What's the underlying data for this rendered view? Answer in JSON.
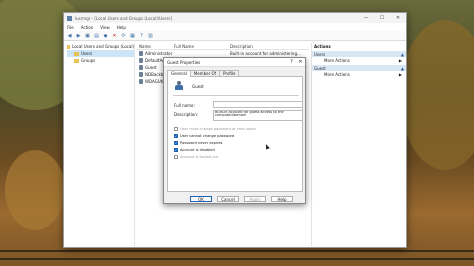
{
  "window": {
    "title": "lusrmgr - [Local Users and Groups (Local)\\Users]",
    "controls": [
      "—",
      "☐",
      "✕"
    ]
  },
  "menu": [
    "File",
    "Action",
    "View",
    "Help"
  ],
  "tree": {
    "root": "Local Users and Groups (Local)",
    "items": [
      "Users",
      "Groups"
    ]
  },
  "list": {
    "headers": {
      "name": "Name",
      "full_name": "Full Name",
      "description": "Description"
    },
    "rows": [
      {
        "name": "Administrator",
        "description": "Built-in account for administering..."
      },
      {
        "name": "DefaultAcc",
        "description": ""
      },
      {
        "name": "Guest",
        "description": ""
      },
      {
        "name": "NDBackb",
        "description": ""
      },
      {
        "name": "WDAGUtility",
        "description": ""
      }
    ]
  },
  "actions": {
    "header": "Actions",
    "sections": [
      {
        "title": "Users",
        "item": "More Actions"
      },
      {
        "title": "Guest",
        "item": "More Actions"
      }
    ]
  },
  "dialog": {
    "title": "Guest Properties",
    "help_btn": "?",
    "close_btn": "✕",
    "tabs": [
      "General",
      "Member Of",
      "Profile"
    ],
    "username": "Guest",
    "full_name_label": "Full name:",
    "full_name_value": "",
    "description_label": "Description:",
    "description_value": "Built-in account for guest access to the computer/domain",
    "checkboxes": [
      {
        "label": "User must change password at next logon",
        "checked": false,
        "disabled": true
      },
      {
        "label": "User cannot change password",
        "checked": true,
        "disabled": false
      },
      {
        "label": "Password never expires",
        "checked": true,
        "disabled": false
      },
      {
        "label": "Account is disabled",
        "checked": true,
        "disabled": false
      },
      {
        "label": "Account is locked out",
        "checked": false,
        "disabled": true
      }
    ],
    "buttons": {
      "ok": "OK",
      "cancel": "Cancel",
      "apply": "Apply",
      "help": "Help"
    }
  }
}
